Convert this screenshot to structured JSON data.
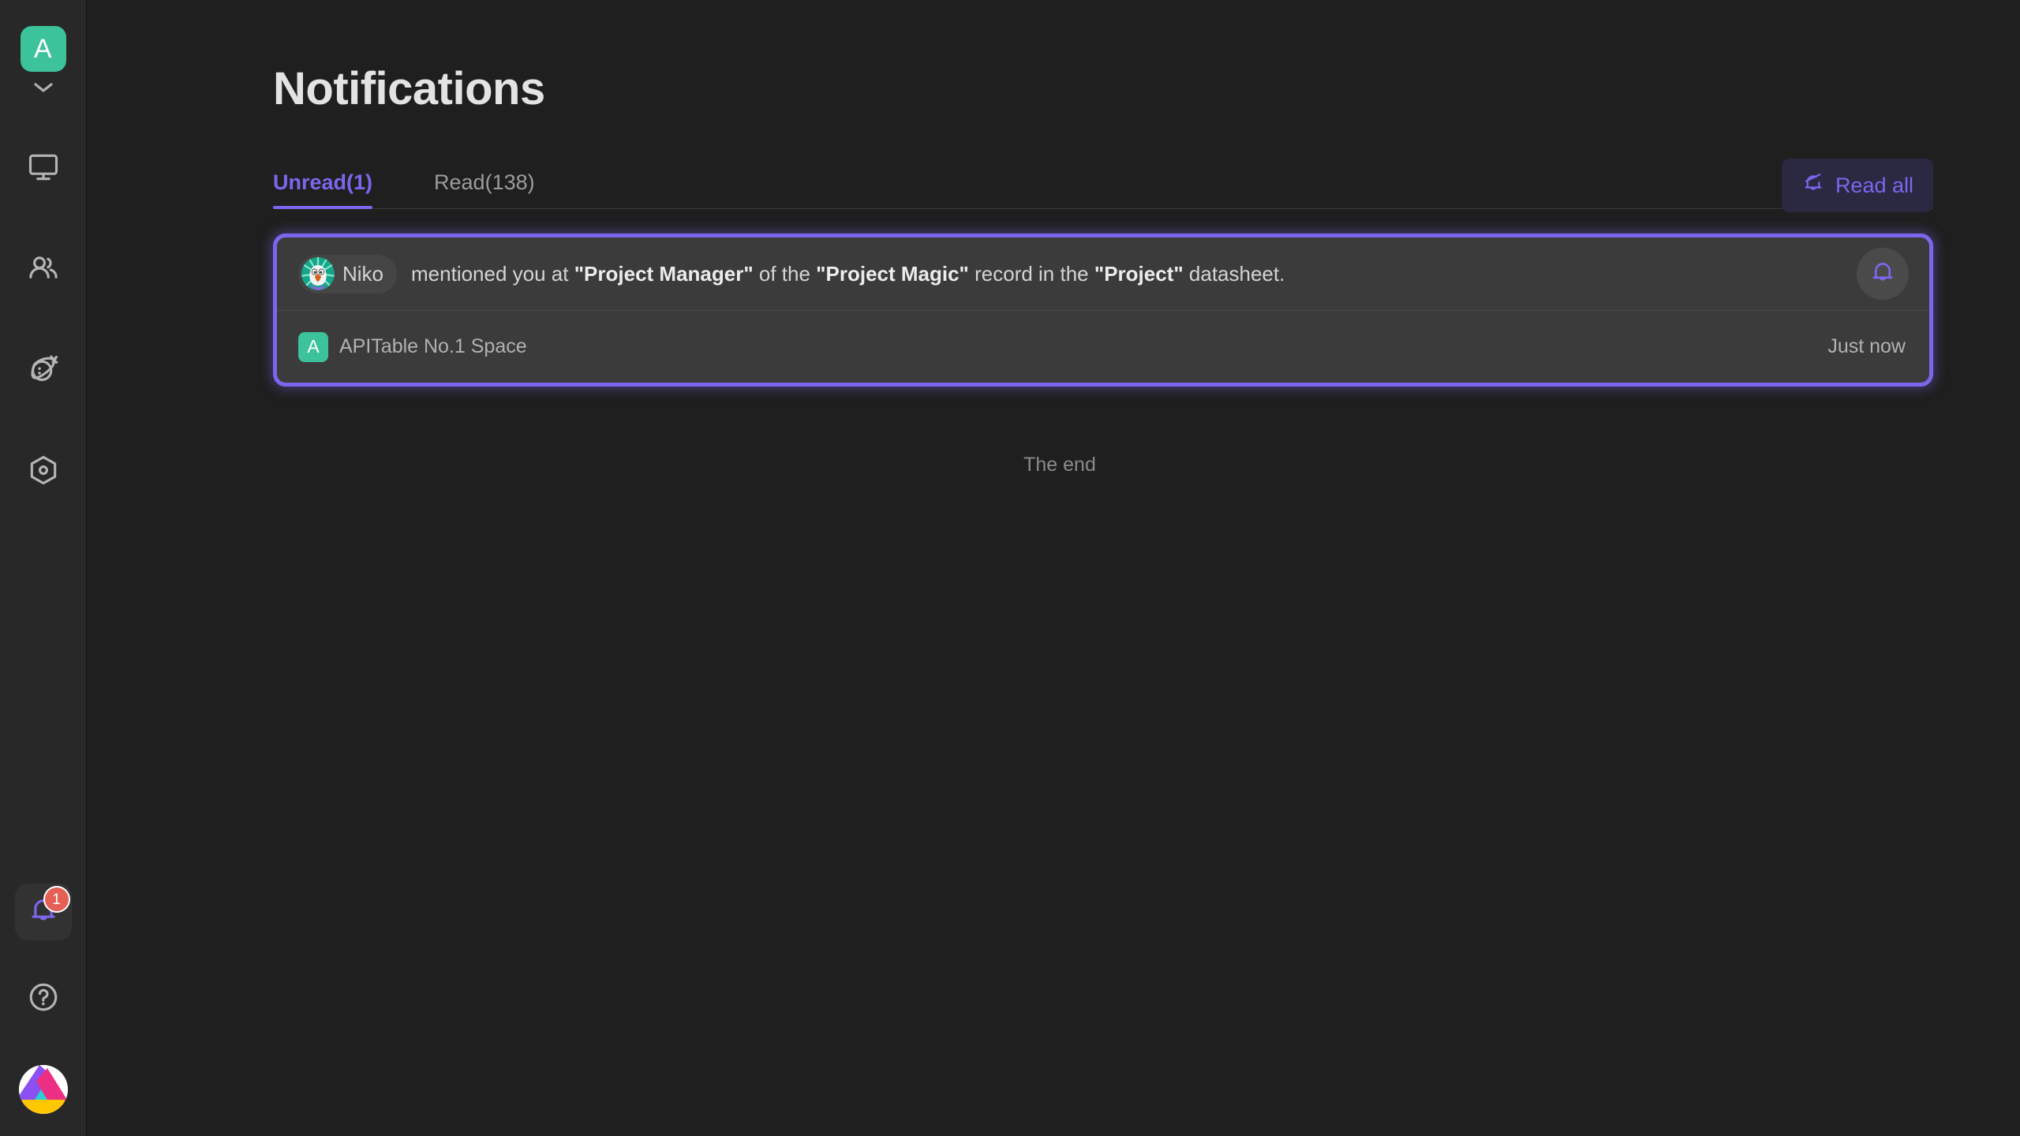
{
  "colors": {
    "accent": "#7b67ee",
    "sidebar_bg": "#282828",
    "main_bg": "#1f1f1f",
    "card_bg": "#3b3b3b",
    "space_green": "#3cc39b",
    "badge_red": "#e45f55"
  },
  "sidebar": {
    "space_avatar_letter": "A",
    "space_switch_icon": "chevron-down-icon",
    "nav_items": [
      {
        "icon": "workbench-monitor-icon",
        "name": "workbench"
      },
      {
        "icon": "members-people-icon",
        "name": "address-book"
      },
      {
        "icon": "planet-space-icon",
        "name": "space-explore"
      },
      {
        "icon": "hexagon-template-icon",
        "name": "template-center"
      }
    ],
    "bottom_items": [
      {
        "icon": "bell-icon",
        "name": "notifications",
        "active": true,
        "badge": "1"
      },
      {
        "icon": "question-circle-icon",
        "name": "help",
        "active": false,
        "badge": ""
      }
    ],
    "logo": {
      "icon": "apitable-logo-icon",
      "name": "apitable-logo"
    }
  },
  "header": {
    "title": "Notifications"
  },
  "tabs": [
    {
      "label": "Unread(1)",
      "active": true
    },
    {
      "label": "Read(138)",
      "active": false
    }
  ],
  "toolbar": {
    "read_all_label": "Read all",
    "read_all_icon": "bell-check-icon"
  },
  "notifications": [
    {
      "user": "Niko",
      "user_avatar_icon": "niko-bird-avatar",
      "message_parts": [
        {
          "text": "mentioned you at ",
          "bold": false
        },
        {
          "text": "\"Project Manager\"",
          "bold": true
        },
        {
          "text": " of the ",
          "bold": false
        },
        {
          "text": "\"Project Magic\"",
          "bold": true
        },
        {
          "text": " record in the ",
          "bold": false
        },
        {
          "text": "\"Project\"",
          "bold": true
        },
        {
          "text": " datasheet.",
          "bold": false
        }
      ],
      "message_plain": "mentioned you at \"Project Manager\" of the \"Project Magic\" record in the \"Project\" datasheet.",
      "space_avatar_letter": "A",
      "space_name": "APITable No.1 Space",
      "time": "Just now",
      "action_icon": "bell-icon",
      "unread": true
    }
  ],
  "footer": {
    "end_label": "The end"
  }
}
